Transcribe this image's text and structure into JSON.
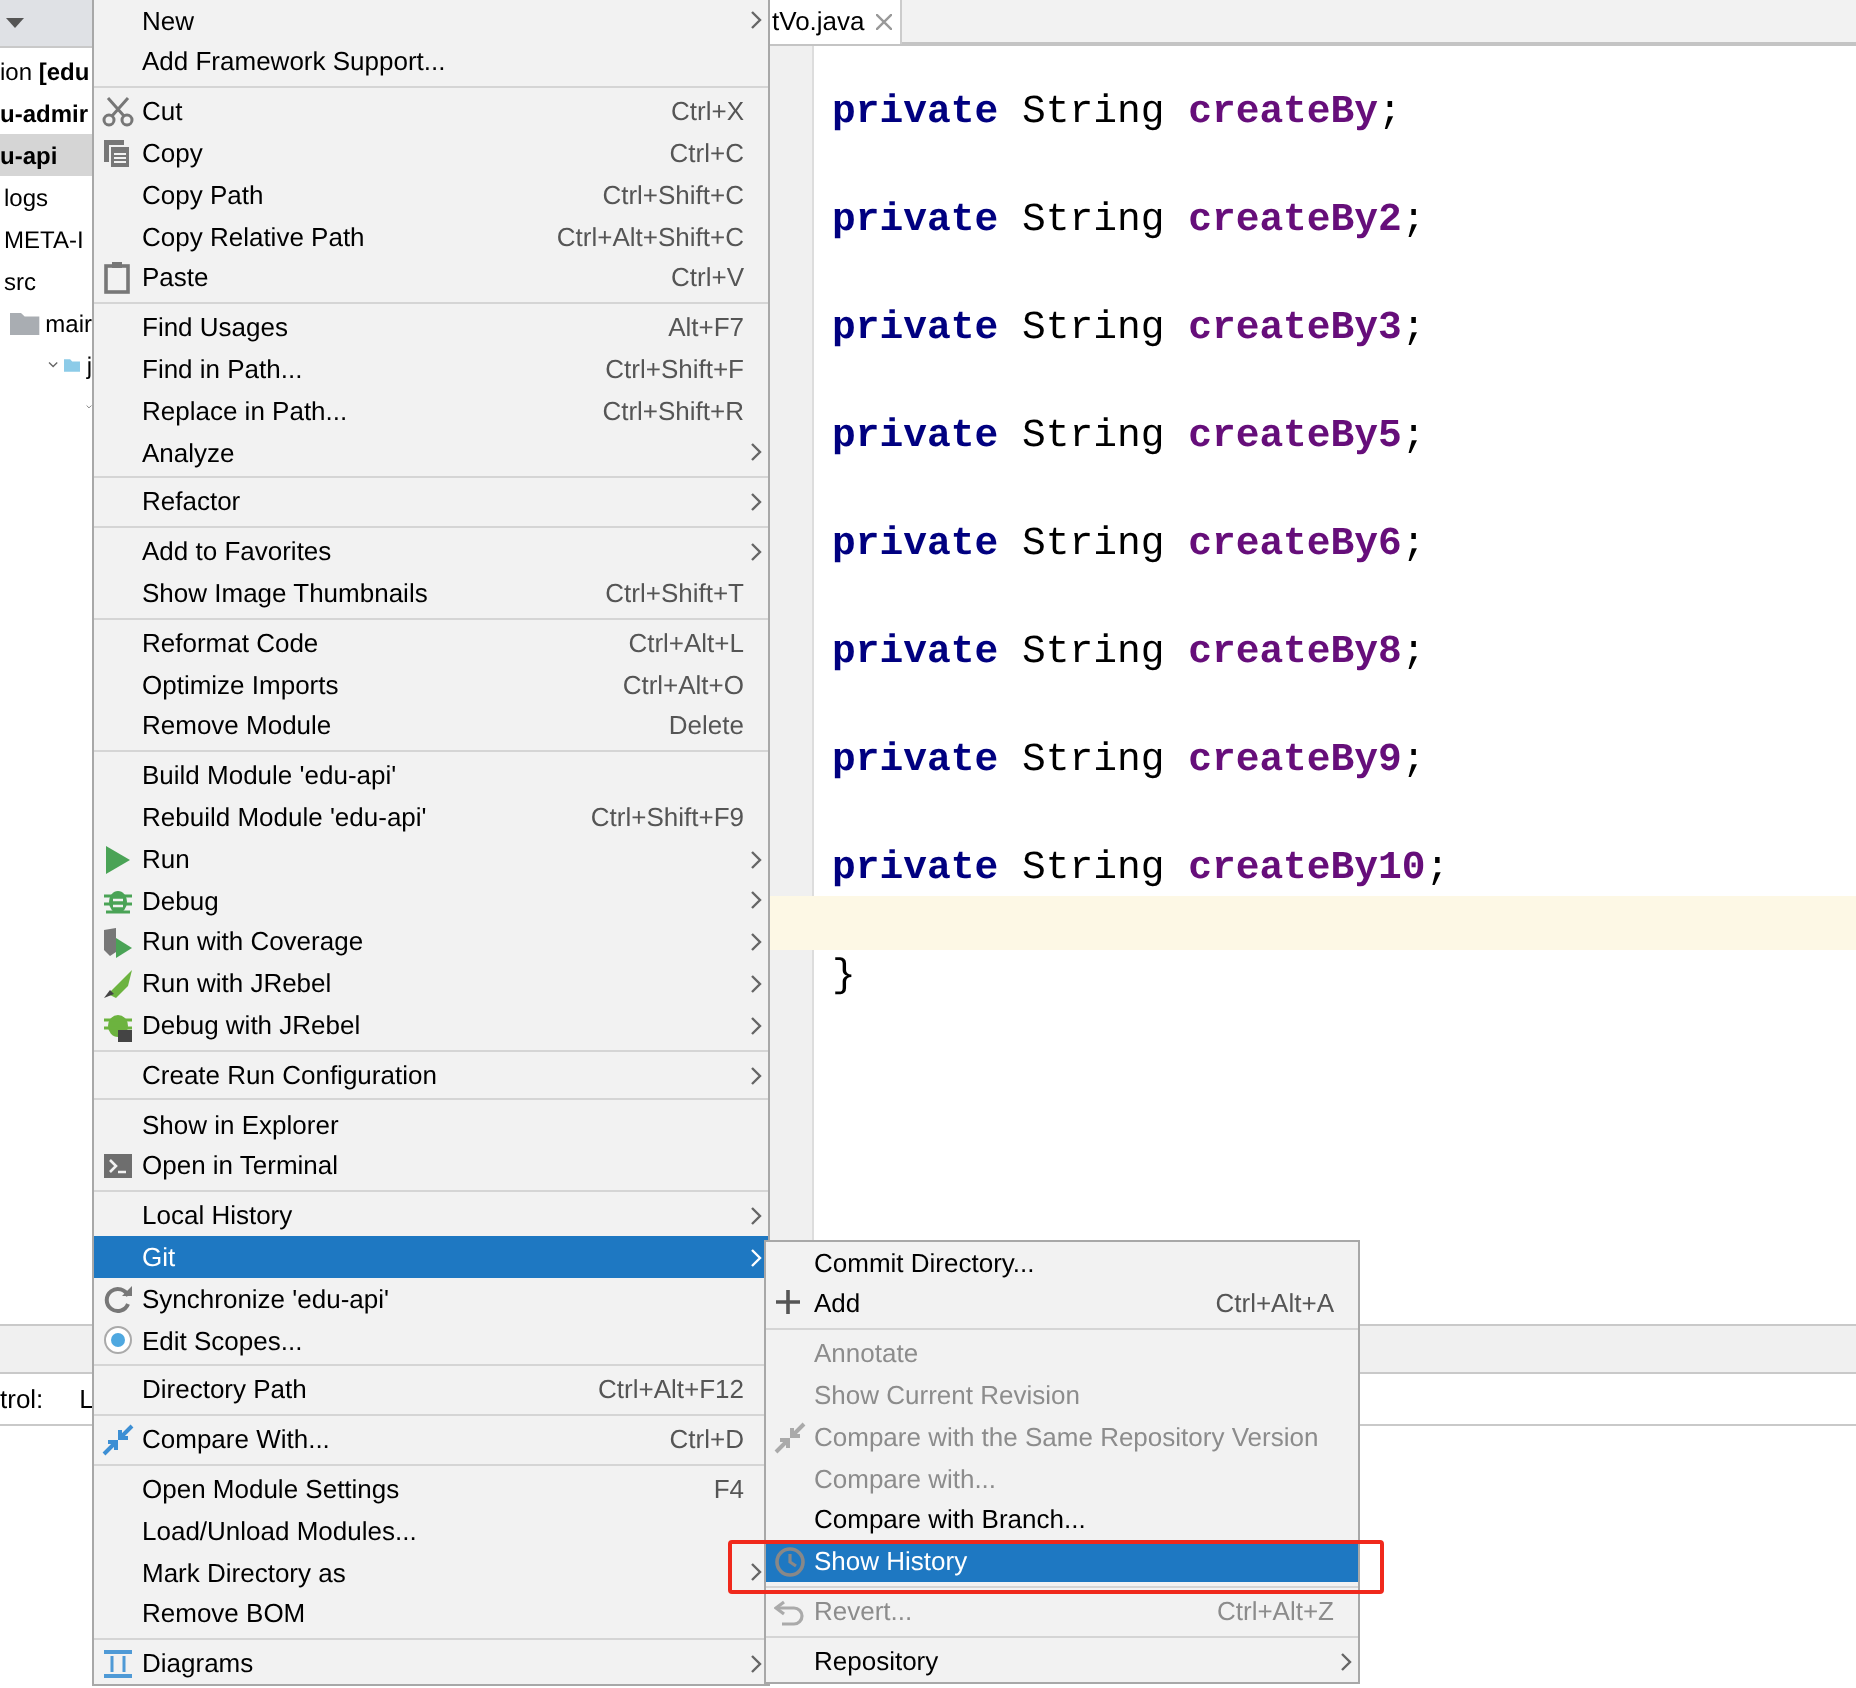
{
  "project_tree": {
    "items": [
      {
        "label": "ion **[edu**",
        "bold": false,
        "selected": false
      },
      {
        "label": "u-admir",
        "bold": true,
        "selected": false
      },
      {
        "label": "u-api",
        "bold": true,
        "selected": true,
        "children": [
          {
            "label": "logs",
            "bold": false,
            "selected": false
          },
          {
            "label": "META-I",
            "bold": false,
            "selected": false
          },
          {
            "label": "src",
            "bold": false,
            "selected": false,
            "children": [
              {
                "label": "mair",
                "bold": false,
                "selected": false,
                "folder": true,
                "children": [
                  {
                    "label": "j",
                    "bold": false,
                    "selected": false,
                    "folder": true,
                    "expanded": true,
                    "children": [
                      {
                        "expanded": true
                      }
                    ]
                  }
                ]
              }
            ]
          }
        ]
      }
    ]
  },
  "editor": {
    "tab": {
      "label": "tVo.java"
    },
    "lines": [
      {
        "kind": "field",
        "modifier": "private",
        "type": "String",
        "field": "createBy",
        "punct": ";"
      },
      {
        "kind": "field",
        "modifier": "private",
        "type": "String",
        "field": "createBy2",
        "punct": ";"
      },
      {
        "kind": "field",
        "modifier": "private",
        "type": "String",
        "field": "createBy3",
        "punct": ";"
      },
      {
        "kind": "field",
        "modifier": "private",
        "type": "String",
        "field": "createBy5",
        "punct": ";"
      },
      {
        "kind": "field",
        "modifier": "private",
        "type": "String",
        "field": "createBy6",
        "punct": ";"
      },
      {
        "kind": "field",
        "modifier": "private",
        "type": "String",
        "field": "createBy8",
        "punct": ";"
      },
      {
        "kind": "field",
        "modifier": "private",
        "type": "String",
        "field": "createBy9",
        "punct": ";"
      },
      {
        "kind": "field",
        "modifier": "private",
        "type": "String",
        "field": "createBy10",
        "punct": ";"
      },
      {
        "kind": "blank",
        "current": true
      },
      {
        "kind": "brace",
        "text": "}",
        "current": false
      }
    ]
  },
  "bottom_panel": {
    "label": "trol:",
    "value": "L"
  },
  "context_menu": {
    "groups": [
      [
        {
          "label": "New",
          "submenu": true,
          "selected": false
        },
        {
          "label": "Add Framework Support...",
          "submenu": false,
          "selected": false
        }
      ],
      [
        {
          "label": "Cut",
          "shortcut": "Ctrl+X",
          "submenu": false,
          "selected": false
        },
        {
          "label": "Copy",
          "shortcut": "Ctrl+C",
          "submenu": false,
          "selected": false
        },
        {
          "label": "Copy Path",
          "shortcut": "Ctrl+Shift+C",
          "submenu": false,
          "selected": false
        },
        {
          "label": "Copy Relative Path",
          "shortcut": "Ctrl+Alt+Shift+C",
          "submenu": false,
          "selected": false
        },
        {
          "label": "Paste",
          "shortcut": "Ctrl+V",
          "submenu": false,
          "selected": false
        }
      ],
      [
        {
          "label": "Find Usages",
          "shortcut": "Alt+F7",
          "submenu": false,
          "selected": false
        },
        {
          "label": "Find in Path...",
          "shortcut": "Ctrl+Shift+F",
          "submenu": false,
          "selected": false
        },
        {
          "label": "Replace in Path...",
          "shortcut": "Ctrl+Shift+R",
          "submenu": false,
          "selected": false
        },
        {
          "label": "Analyze",
          "submenu": true,
          "selected": false
        }
      ],
      [
        {
          "label": "Refactor",
          "submenu": true,
          "selected": false
        }
      ],
      [
        {
          "label": "Add to Favorites",
          "submenu": true,
          "selected": false
        },
        {
          "label": "Show Image Thumbnails",
          "shortcut": "Ctrl+Shift+T",
          "submenu": false,
          "selected": false
        }
      ],
      [
        {
          "label": "Reformat Code",
          "shortcut": "Ctrl+Alt+L",
          "submenu": false,
          "selected": false
        },
        {
          "label": "Optimize Imports",
          "shortcut": "Ctrl+Alt+O",
          "submenu": false,
          "selected": false
        },
        {
          "label": "Remove Module",
          "shortcut": "Delete",
          "submenu": false,
          "selected": false
        }
      ],
      [
        {
          "label": "Build Module 'edu-api'",
          "submenu": false,
          "selected": false
        },
        {
          "label": "Rebuild Module 'edu-api'",
          "shortcut": "Ctrl+Shift+F9",
          "submenu": false,
          "selected": false
        },
        {
          "label": "Run",
          "submenu": true,
          "selected": false
        },
        {
          "label": "Debug",
          "submenu": true,
          "selected": false
        },
        {
          "label": "Run with Coverage",
          "submenu": true,
          "selected": false
        },
        {
          "label": "Run with JRebel",
          "submenu": true,
          "selected": false
        },
        {
          "label": "Debug with JRebel",
          "submenu": true,
          "selected": false
        }
      ],
      [
        {
          "label": "Create Run Configuration",
          "submenu": true,
          "selected": false
        }
      ],
      [
        {
          "label": "Show in Explorer",
          "submenu": false,
          "selected": false
        },
        {
          "label": "Open in Terminal",
          "submenu": false,
          "selected": false
        }
      ],
      [
        {
          "label": "Local History",
          "submenu": true,
          "selected": false
        },
        {
          "label": "Git",
          "submenu": true,
          "selected": true
        },
        {
          "label": "Synchronize 'edu-api'",
          "submenu": false,
          "selected": false
        },
        {
          "label": "Edit Scopes...",
          "submenu": false,
          "selected": false
        }
      ],
      [
        {
          "label": "Directory Path",
          "shortcut": "Ctrl+Alt+F12",
          "submenu": false,
          "selected": false
        }
      ],
      [
        {
          "label": "Compare With...",
          "shortcut": "Ctrl+D",
          "submenu": false,
          "selected": false
        }
      ],
      [
        {
          "label": "Open Module Settings",
          "shortcut": "F4",
          "submenu": false,
          "selected": false
        },
        {
          "label": "Load/Unload Modules...",
          "submenu": false,
          "selected": false
        },
        {
          "label": "Mark Directory as",
          "submenu": true,
          "selected": false
        },
        {
          "label": "Remove BOM",
          "submenu": false,
          "selected": false
        }
      ],
      [
        {
          "label": "Diagrams",
          "submenu": true,
          "selected": false
        }
      ]
    ]
  },
  "git_submenu": {
    "groups": [
      [
        {
          "label": "Commit Directory...",
          "submenu": false,
          "selected": false,
          "disabled": false
        },
        {
          "label": "Add",
          "shortcut": "Ctrl+Alt+A",
          "submenu": false,
          "selected": false,
          "disabled": false
        }
      ],
      [
        {
          "label": "Annotate",
          "submenu": false,
          "selected": false,
          "disabled": true
        },
        {
          "label": "Show Current Revision",
          "submenu": false,
          "selected": false,
          "disabled": true
        },
        {
          "label": "Compare with the Same Repository Version",
          "submenu": false,
          "selected": false,
          "disabled": true
        },
        {
          "label": "Compare with...",
          "submenu": false,
          "selected": false,
          "disabled": true
        },
        {
          "label": "Compare with Branch...",
          "submenu": false,
          "selected": false,
          "disabled": false
        },
        {
          "label": "Show History",
          "submenu": false,
          "selected": true,
          "disabled": false,
          "annotated": true
        }
      ],
      [
        {
          "label": "Revert...",
          "shortcut": "Ctrl+Alt+Z",
          "submenu": false,
          "selected": false,
          "disabled": true
        }
      ],
      [
        {
          "label": "Repository",
          "submenu": true,
          "selected": false,
          "disabled": false
        }
      ]
    ]
  }
}
